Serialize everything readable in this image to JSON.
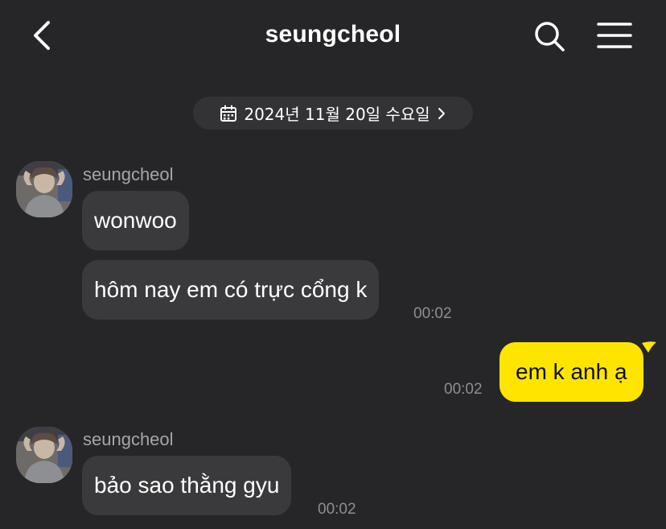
{
  "header": {
    "title": "seungcheol"
  },
  "date_divider": {
    "label": "2024년 11월 20일 수요일"
  },
  "messages": [
    {
      "sender": "seungcheol",
      "text": "wonwoo"
    },
    {
      "text": "hôm nay em có trực cổng k",
      "time": "00:02"
    },
    {
      "sender": "me",
      "text": "em k anh ạ",
      "time": "00:02"
    },
    {
      "sender": "seungcheol",
      "text": "bảo sao thằng gyu",
      "time": "00:02"
    }
  ],
  "group_senders": [
    "seungcheol",
    "seungcheol"
  ],
  "colors": {
    "background": "#262628",
    "incoming_bubble": "#3a3a3c",
    "outgoing_bubble": "#fee500",
    "timestamp": "#8e8e93"
  },
  "icons": [
    "back-arrow-icon",
    "search-icon",
    "menu-icon",
    "calendar-icon",
    "chevron-right-icon",
    "avatar-photo"
  ]
}
